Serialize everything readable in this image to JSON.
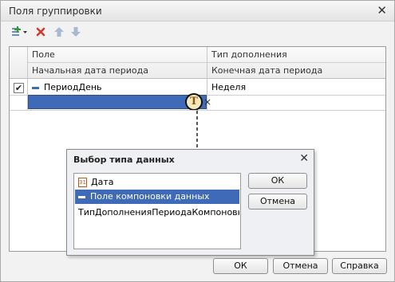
{
  "window": {
    "title": "Поля группировки"
  },
  "toolbar": {
    "add_icon": "add-row-icon",
    "delete_icon": "delete-icon",
    "up_icon": "move-up-icon",
    "down_icon": "move-down-icon"
  },
  "grid": {
    "columns": {
      "col1_top": "Поле",
      "col1_bottom": "Начальная дата периода",
      "col2_top": "Тип дополнения",
      "col2_bottom": "Конечная дата периода"
    },
    "rows": [
      {
        "checked": true,
        "field": "ПериодДень",
        "addition_type": "Неделя"
      }
    ],
    "edit_row": {
      "choose_type_button": "T",
      "clear_button": "×"
    }
  },
  "type_dialog": {
    "title": "Выбор типа данных",
    "items": [
      {
        "label": "Дата",
        "icon": "calendar-icon",
        "icon_text": "31"
      },
      {
        "label": "Поле компоновки данных",
        "icon": "field-icon",
        "selected": true
      },
      {
        "label": "ТипДополненияПериодаКомпоновки..."
      }
    ],
    "ok_label": "ОК",
    "cancel_label": "Отмена"
  },
  "footer": {
    "ok_label": "ОК",
    "cancel_label": "Отмена",
    "help_label": "Справка"
  },
  "colors": {
    "selection": "#3e6ab8",
    "add_icon": "#2f9e2f",
    "delete_icon": "#d03a2a"
  }
}
